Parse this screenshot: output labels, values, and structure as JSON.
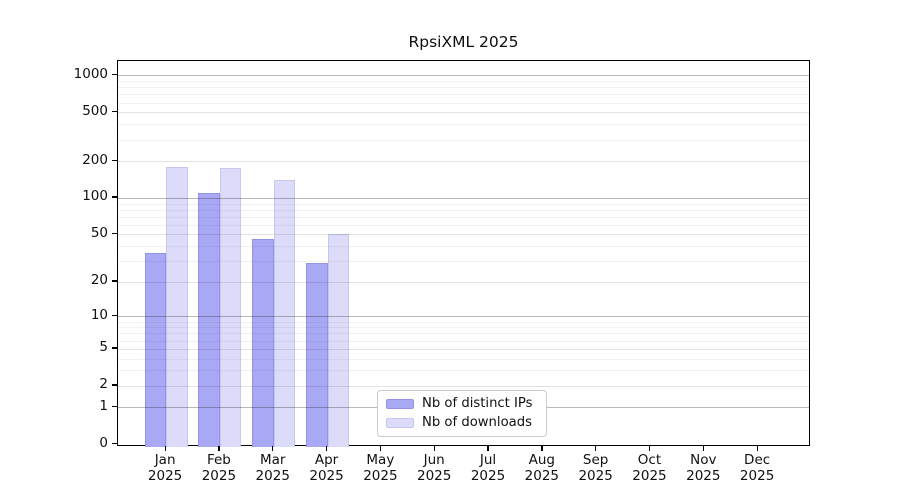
{
  "title": "RpsiXML 2025",
  "colors": {
    "ips_bar": "#a8a8f4",
    "ips_bar_border": "#9292e6",
    "downloads_bar": "#dcdcfa",
    "downloads_bar_border": "#c7c7f0",
    "axis": "#000000",
    "text": "#111111",
    "legend_border": "#cbcbcb"
  },
  "chart_data": {
    "type": "bar",
    "title": "RpsiXML 2025",
    "y_scale": "log10(1+x)",
    "y_ticks": [
      0,
      1,
      2,
      5,
      10,
      20,
      50,
      100,
      200,
      500,
      1000
    ],
    "ylim": [
      0,
      1300
    ],
    "grid": "on",
    "legend_position": "inside-bottom-center",
    "x_months": [
      "Jan",
      "Feb",
      "Mar",
      "Apr",
      "May",
      "Jun",
      "Jul",
      "Aug",
      "Sep",
      "Oct",
      "Nov",
      "Dec"
    ],
    "x_year": "2025",
    "categories": [
      "Jan 2025",
      "Feb 2025",
      "Mar 2025",
      "Apr 2025",
      "May 2025",
      "Jun 2025",
      "Jul 2025",
      "Aug 2025",
      "Sep 2025",
      "Oct 2025",
      "Nov 2025",
      "Dec 2025"
    ],
    "series": [
      {
        "name": "Nb of distinct IPs",
        "values": [
          35,
          110,
          46,
          29,
          0,
          0,
          0,
          0,
          0,
          0,
          0,
          0
        ]
      },
      {
        "name": "Nb of downloads",
        "values": [
          180,
          175,
          140,
          50,
          0,
          0,
          0,
          0,
          0,
          0,
          0,
          0
        ]
      }
    ]
  }
}
